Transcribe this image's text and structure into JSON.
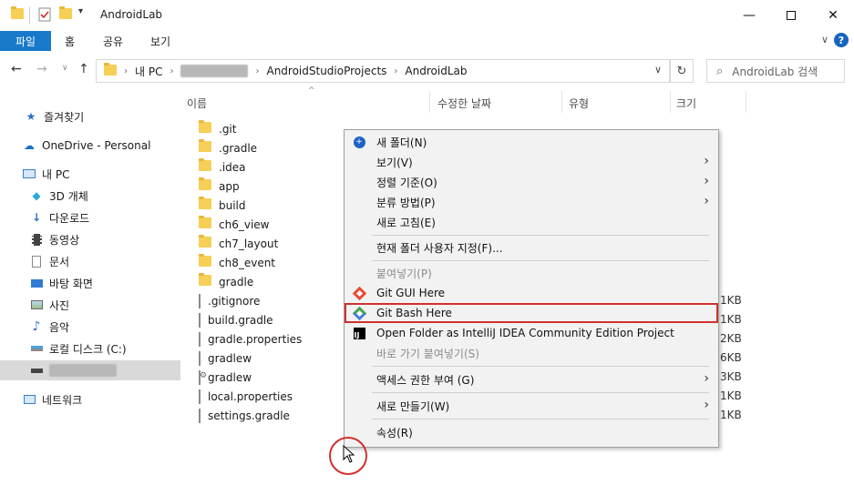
{
  "window": {
    "title": "AndroidLab",
    "minimize_icon": "minimize-icon",
    "maximize_icon": "maximize-icon",
    "close_icon": "close-icon"
  },
  "ribbon": {
    "tabs": [
      "파일",
      "홈",
      "공유",
      "보기"
    ],
    "help_label": "?"
  },
  "address": {
    "crumbs": [
      "내 PC",
      "AndroidStudioProjects",
      "AndroidLab"
    ],
    "search_placeholder": "AndroidLab 검색"
  },
  "sidebar": {
    "items": [
      {
        "label": "즐겨찾기",
        "icon": "star-icon"
      },
      {
        "label": "OneDrive - Personal",
        "icon": "cloud-icon"
      },
      {
        "label": "내 PC",
        "icon": "computer-icon"
      },
      {
        "label": "3D 개체",
        "icon": "cube-icon"
      },
      {
        "label": "다운로드",
        "icon": "download-icon"
      },
      {
        "label": "동영상",
        "icon": "video-icon"
      },
      {
        "label": "문서",
        "icon": "document-icon"
      },
      {
        "label": "바탕 화면",
        "icon": "desktop-icon"
      },
      {
        "label": "사진",
        "icon": "picture-icon"
      },
      {
        "label": "음악",
        "icon": "music-icon"
      },
      {
        "label": "로컬 디스크 (C:)",
        "icon": "drive-icon"
      },
      {
        "label": "네트워크",
        "icon": "network-icon"
      }
    ]
  },
  "columns": [
    "이름",
    "수정한 날짜",
    "유형",
    "크기"
  ],
  "files": [
    {
      "name": ".git",
      "type": "folder"
    },
    {
      "name": ".gradle",
      "type": "folder"
    },
    {
      "name": ".idea",
      "type": "folder"
    },
    {
      "name": "app",
      "type": "folder"
    },
    {
      "name": "build",
      "type": "folder"
    },
    {
      "name": "ch6_view",
      "type": "folder"
    },
    {
      "name": "ch7_layout",
      "type": "folder"
    },
    {
      "name": "ch8_event",
      "type": "folder"
    },
    {
      "name": "gradle",
      "type": "folder"
    },
    {
      "name": ".gitignore",
      "type": "file",
      "size": "1KB"
    },
    {
      "name": "build.gradle",
      "type": "file",
      "size": "1KB"
    },
    {
      "name": "gradle.properties",
      "type": "file",
      "size": "2KB"
    },
    {
      "name": "gradlew",
      "type": "file",
      "size": "6KB"
    },
    {
      "name": "gradlew",
      "type": "gear",
      "size": "3KB"
    },
    {
      "name": "local.properties",
      "type": "file",
      "size": "1KB"
    },
    {
      "name": "settings.gradle",
      "type": "file",
      "size": "1KB"
    }
  ],
  "context_menu": {
    "items": [
      {
        "label": "새 폴더(N)",
        "icon": "new-folder-icon"
      },
      {
        "label": "보기(V)",
        "submenu": true
      },
      {
        "label": "정렬 기준(O)",
        "submenu": true
      },
      {
        "label": "분류 방법(P)",
        "submenu": true
      },
      {
        "label": "새로 고침(E)"
      },
      {
        "label": "현재 폴더 사용자 지정(F)..."
      },
      {
        "label": "붙여넣기(P)",
        "disabled": true
      },
      {
        "label": "Git GUI Here",
        "icon": "git-gui-icon"
      },
      {
        "label": "Git Bash Here",
        "icon": "git-bash-icon",
        "highlighted": true
      },
      {
        "label": "Open Folder as IntelliJ IDEA Community Edition Project",
        "icon": "intellij-icon"
      },
      {
        "label": "바로 가기 붙여넣기(S)",
        "disabled": true
      },
      {
        "label": "액세스 권한 부여 (G)",
        "submenu": true
      },
      {
        "label": "새로 만들기(W)",
        "submenu": true
      },
      {
        "label": "속성(R)"
      }
    ]
  }
}
